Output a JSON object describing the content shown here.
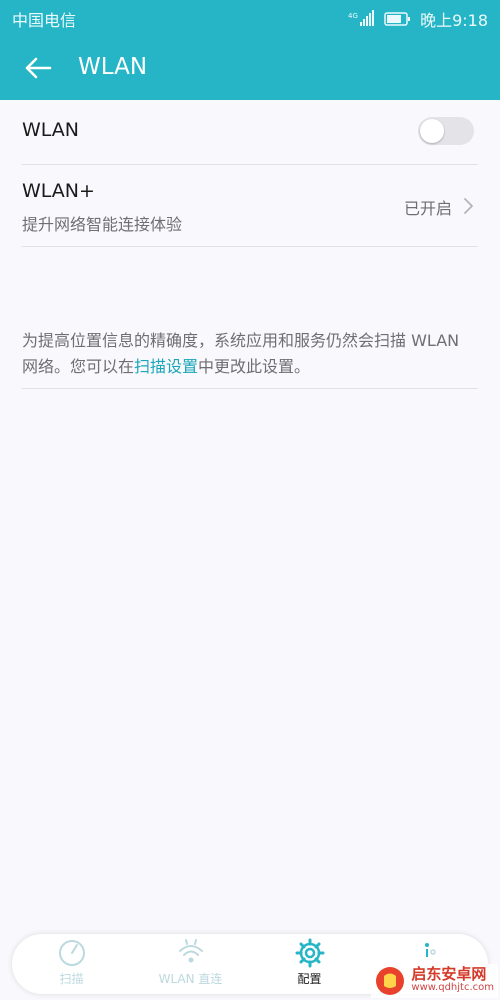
{
  "status_bar": {
    "carrier": "中国电信",
    "network": "4G",
    "time": "晚上9:18"
  },
  "toolbar": {
    "back_icon": "arrow-left-icon",
    "title": "WLAN"
  },
  "wlan_row": {
    "label": "WLAN",
    "enabled": false
  },
  "wlan_plus_row": {
    "label": "WLAN+",
    "subtitle": "提升网络智能连接体验",
    "value": "已开启"
  },
  "info": {
    "text_before": "为提高位置信息的精确度，系统应用和服务仍然会扫描 WLAN 网络。您可以在",
    "link_text": "扫描设置",
    "text_after": "中更改此设置。"
  },
  "bottom_nav": {
    "items": [
      {
        "label": "扫描",
        "icon": "scan-icon"
      },
      {
        "label": "WLAN 直连",
        "icon": "wifi-direct-icon"
      },
      {
        "label": "配置",
        "icon": "gear-icon"
      },
      {
        "label": "",
        "icon": "more-icon"
      }
    ],
    "active": "配置"
  },
  "colors": {
    "accent": "#26b5c6",
    "link": "#1aa6b9",
    "background": "#f9f8fc"
  },
  "watermark": {
    "title": "启东安卓网",
    "url": "www.qdhjtc.com"
  }
}
